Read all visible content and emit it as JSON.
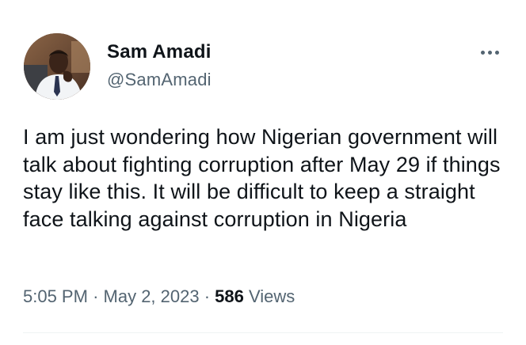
{
  "author": {
    "display_name": "Sam Amadi",
    "handle": "@SamAmadi",
    "avatar": "profile-photo"
  },
  "more_icon": "more-horizontal-icon",
  "tweet": {
    "text": "I am just wondering how Nigerian government will talk about fighting corruption after May 29 if things stay like this. It will be difficult to keep a straight face talking against corruption in Nigeria",
    "time": "5:05 PM",
    "separator": "·",
    "date": "May 2, 2023",
    "views_count": "586",
    "views_label": "Views"
  },
  "colors": {
    "text_primary": "#0f1419",
    "text_secondary": "#536471",
    "divider": "#eff3f4"
  }
}
